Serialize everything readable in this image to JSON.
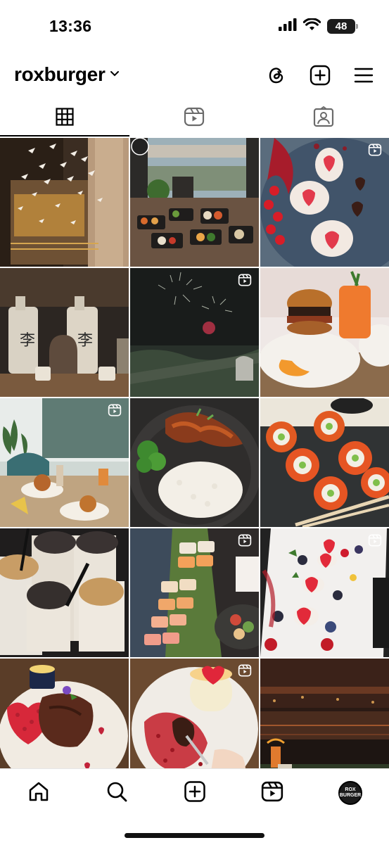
{
  "status_bar": {
    "time": "13:36",
    "battery": "48"
  },
  "header": {
    "username": "roxburger"
  },
  "tabs": [
    {
      "id": "posts",
      "icon": "grid-icon",
      "active": true
    },
    {
      "id": "reels",
      "icon": "reels-icon",
      "active": false
    },
    {
      "id": "tagged",
      "icon": "tagged-icon",
      "active": false
    }
  ],
  "grid": {
    "posts": [
      {
        "description": "paper crane installation ceiling",
        "is_reel": false
      },
      {
        "description": "sushi platter by window",
        "is_reel": false
      },
      {
        "description": "heart mochi dessert",
        "is_reel": true
      },
      {
        "description": "sake bottles and cups",
        "is_reel": false
      },
      {
        "description": "fireworks over river",
        "is_reel": true
      },
      {
        "description": "burger with orange drink",
        "is_reel": false
      },
      {
        "description": "dining table with burgers",
        "is_reel": true
      },
      {
        "description": "chicken rice bowl",
        "is_reel": false
      },
      {
        "description": "sushi rolls on slate",
        "is_reel": false
      },
      {
        "description": "oreo milkshakes",
        "is_reel": false
      },
      {
        "description": "sushi board and poke",
        "is_reel": true
      },
      {
        "description": "heart desserts plate",
        "is_reel": true
      },
      {
        "description": "steak with heart cake",
        "is_reel": false
      },
      {
        "description": "heart cheesecake dessert",
        "is_reel": true
      },
      {
        "description": "night terrace view",
        "is_reel": false
      }
    ],
    "avatar_text_line1": "ROX",
    "avatar_text_line2": "BURGER"
  },
  "bottom_nav": [
    {
      "id": "home",
      "icon": "home-icon"
    },
    {
      "id": "search",
      "icon": "search-icon"
    },
    {
      "id": "create",
      "icon": "create-icon"
    },
    {
      "id": "reels",
      "icon": "reels-nav-icon"
    },
    {
      "id": "profile",
      "icon": "profile-avatar"
    }
  ],
  "colors": {
    "accent": "#000000",
    "background": "#ffffff"
  }
}
